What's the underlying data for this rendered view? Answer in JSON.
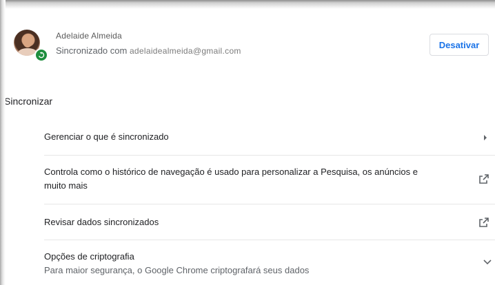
{
  "account": {
    "name": "Adelaide Almeida",
    "sync_prefix": "Sincronizado com ",
    "email": "adelaidealmeida@gmail.com",
    "turn_off_label": "Desativar",
    "avatar_icon": "user-avatar",
    "badge_icon": "sync-icon"
  },
  "section": {
    "title": "Sincronizar"
  },
  "items": [
    {
      "label": "Gerenciar o que é sincronizado",
      "icon": "chevron-right-icon"
    },
    {
      "label_line1": "Controla como o histórico de navegação é usado para personalizar a Pesquisa, os anúncios e",
      "label_line2": "muito mais",
      "icon": "external-link-icon"
    },
    {
      "label": "Revisar dados sincronizados",
      "icon": "external-link-icon"
    },
    {
      "label": "Opções de criptografia",
      "sublabel": "Para maior segurança, o Google Chrome criptografará seus dados",
      "icon": "chevron-down-icon"
    }
  ],
  "colors": {
    "accent": "#1a73e8",
    "sync_badge": "#1e8e3e",
    "text_primary": "#202124",
    "text_secondary": "#5f6368"
  }
}
